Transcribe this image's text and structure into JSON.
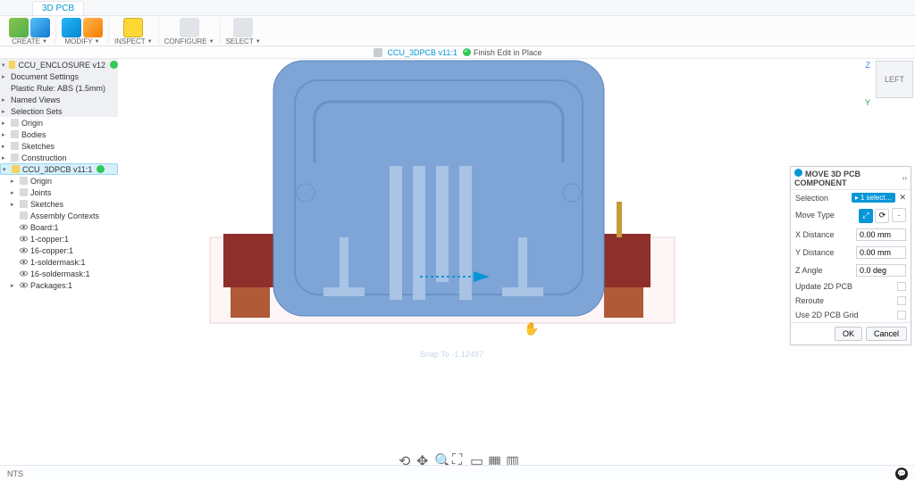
{
  "ribbon": {
    "active_tab": "3D PCB",
    "groups": [
      {
        "label": "CREATE",
        "icons": [
          "cube-green-icon",
          "cube-blue-icon"
        ]
      },
      {
        "label": "MODIFY",
        "icons": [
          "warp-icon",
          "move-icon"
        ]
      },
      {
        "label": "INSPECT",
        "icons": [
          "ruler-icon"
        ]
      },
      {
        "label": "CONFIGURE",
        "icons": [
          "gear-icon"
        ]
      },
      {
        "label": "SELECT",
        "icons": [
          "cursor-icon"
        ]
      }
    ]
  },
  "breadcrumb": {
    "icon": "file-link-icon",
    "link": "CCU_3DPCB v11:1",
    "status": "Finish Edit in Place"
  },
  "browser": {
    "root": "CCU_ENCLOSURE v12",
    "nodes": [
      "Document Settings",
      "Plastic Rule: ABS (1.5mm)",
      "Named Views",
      "Selection Sets",
      "Origin",
      "Bodies",
      "Sketches",
      "Construction"
    ],
    "active_component": "CCU_3DPCB v11:1",
    "sub": [
      "Origin",
      "Joints",
      "Sketches",
      "Assembly Contexts",
      "Board:1",
      "1-copper:1",
      "16-copper:1",
      "1-soldermask:1",
      "16-soldermask:1",
      "Packages:1"
    ]
  },
  "viewcube": {
    "face": "LEFT",
    "axes": {
      "z": "Z",
      "y": "Y"
    }
  },
  "snap": "Snap To -1.12497",
  "dialog": {
    "title": "MOVE 3D PCB COMPONENT",
    "rows": {
      "selection_label": "Selection",
      "selection_chip": "1 select…",
      "movetype_label": "Move Type",
      "x_label": "X Distance",
      "x_val": "0.00 mm",
      "y_label": "Y Distance",
      "y_val": "0.00 mm",
      "z_label": "Z Angle",
      "z_val": "0.0 deg",
      "update_label": "Update 2D PCB",
      "reroute_label": "Reroute",
      "grid_label": "Use 2D PCB Grid"
    },
    "buttons": {
      "ok": "OK",
      "cancel": "Cancel"
    }
  },
  "statusbar": {
    "left_text": "NTS"
  }
}
